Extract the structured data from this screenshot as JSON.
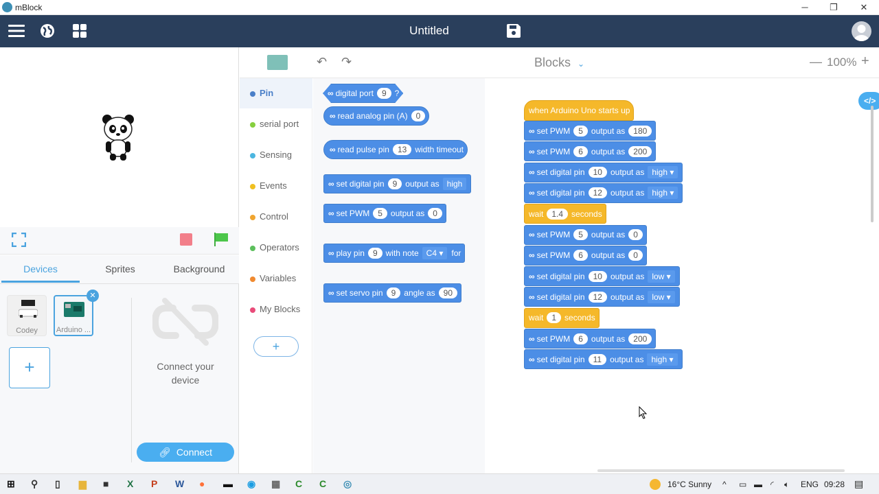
{
  "window": {
    "app_name": "mBlock",
    "controls": {
      "minimize": "─",
      "restore": "❐",
      "close": "✕"
    }
  },
  "topbar": {
    "title": "Untitled",
    "icons": [
      "menu-icon",
      "globe-icon",
      "grid-icon",
      "save-icon",
      "user-avatar"
    ]
  },
  "stage": {
    "sprite": "panda",
    "controls": {
      "fullscreen": "fullscreen-icon",
      "stop": "stop-icon",
      "go": "green-flag-icon"
    },
    "colors": {
      "stop": "#f27f8a",
      "go": "#4cc64a",
      "accent": "#4aa3df"
    }
  },
  "tabs": [
    {
      "label": "Devices",
      "active": true
    },
    {
      "label": "Sprites",
      "active": false
    },
    {
      "label": "Background",
      "active": false
    }
  ],
  "devices": {
    "items": [
      {
        "label": "Codey",
        "selected": false
      },
      {
        "label": "Arduino ...",
        "selected": true
      }
    ],
    "add_label": "+",
    "connect_prompt_line1": "Connect your",
    "connect_prompt_line2": "device",
    "connect_button": "Connect"
  },
  "editor_toolbar": {
    "mode": "Blocks",
    "zoom": "100%",
    "zoom_out": "—",
    "zoom_in": "+",
    "code_toggle": "</>"
  },
  "categories": [
    {
      "label": "Pin",
      "color": "#4a7fc8",
      "active": true
    },
    {
      "label": "serial port",
      "color": "#86cf3f",
      "active": false
    },
    {
      "label": "Sensing",
      "color": "#4cb6e0",
      "active": false
    },
    {
      "label": "Events",
      "color": "#f0c020",
      "active": false
    },
    {
      "label": "Control",
      "color": "#f0a530",
      "active": false
    },
    {
      "label": "Operators",
      "color": "#5cbf5c",
      "active": false
    },
    {
      "label": "Variables",
      "color": "#f08a30",
      "active": false
    },
    {
      "label": "My Blocks",
      "color": "#e94c7a",
      "active": false
    }
  ],
  "add_extension": "+",
  "palette": [
    {
      "parts": [
        "digital port",
        "[9]",
        "?"
      ]
    },
    {
      "parts": [
        "read analog pin  (A)",
        "[0]"
      ]
    },
    {
      "parts": [
        "read pulse pin",
        "[13]",
        "width timeout"
      ]
    },
    {
      "parts": [
        "set digital pin",
        "[9]",
        "output as",
        "{high"
      ]
    },
    {
      "parts": [
        "set PWM",
        "[5]",
        "output as",
        "[0]"
      ]
    },
    {
      "parts": [
        "play pin",
        "[9]",
        "with note",
        "{C4 ▾",
        "for"
      ]
    },
    {
      "parts": [
        "set servo pin",
        "[9]",
        "angle as",
        "[90]"
      ]
    }
  ],
  "script": [
    {
      "type": "hat",
      "parts": [
        "when Arduino Uno starts up"
      ]
    },
    {
      "type": "cmd",
      "parts": [
        "set PWM",
        "[5]",
        "output as",
        "[180]"
      ]
    },
    {
      "type": "cmd",
      "parts": [
        "set PWM",
        "[6]",
        "output as",
        "[200]"
      ]
    },
    {
      "type": "cmd",
      "parts": [
        "set digital pin",
        "[10]",
        "output as",
        "{high ▾"
      ]
    },
    {
      "type": "cmd",
      "parts": [
        "set digital pin",
        "[12]",
        "output as",
        "{high ▾"
      ]
    },
    {
      "type": "wait",
      "parts": [
        "wait",
        "[1.4]",
        "seconds"
      ]
    },
    {
      "type": "cmd",
      "parts": [
        "set PWM",
        "[5]",
        "output as",
        "[0]"
      ]
    },
    {
      "type": "cmd",
      "parts": [
        "set PWM",
        "[6]",
        "output as",
        "[0]"
      ]
    },
    {
      "type": "cmd",
      "parts": [
        "set digital pin",
        "[10]",
        "output as",
        "{low ▾"
      ]
    },
    {
      "type": "cmd",
      "parts": [
        "set digital pin",
        "[12]",
        "output as",
        "{low ▾"
      ]
    },
    {
      "type": "wait",
      "parts": [
        "wait",
        "[1]",
        "seconds"
      ]
    },
    {
      "type": "cmd",
      "parts": [
        "set PWM",
        "[6]",
        "output as",
        "[200]"
      ]
    },
    {
      "type": "cmd",
      "parts": [
        "set digital pin",
        "[11]",
        "output as",
        "{high ▾"
      ]
    }
  ],
  "taskbar": {
    "apps": [
      "start-icon",
      "search-icon",
      "task-view-icon",
      "file-explorer-icon",
      "store-icon",
      "excel-icon",
      "powerpoint-icon",
      "word-icon",
      "firefox-icon",
      "terminal-icon",
      "edge-icon",
      "calculator-icon",
      "camtasia-icon",
      "camtasia-recorder-icon",
      "mblock-icon"
    ],
    "weather": "16°C  Sunny",
    "language": "ENG",
    "time": "09:28"
  }
}
